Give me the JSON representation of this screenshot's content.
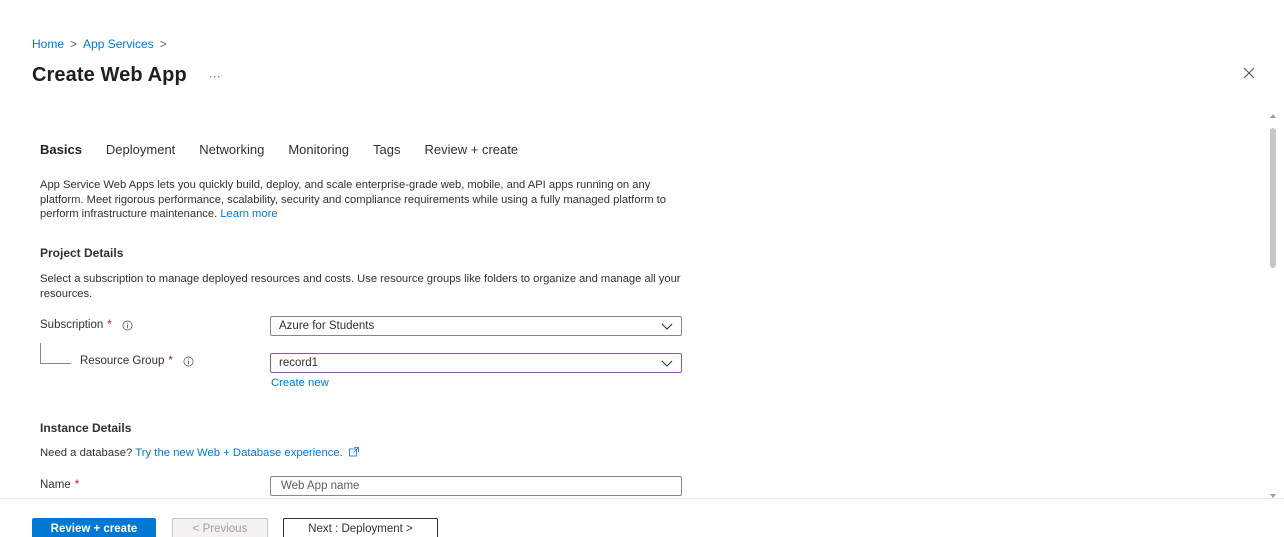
{
  "breadcrumb": {
    "home": "Home",
    "sep": ">",
    "app_services": "App Services"
  },
  "header": {
    "title": "Create Web App",
    "more": "···"
  },
  "tabs": [
    {
      "label": "Basics"
    },
    {
      "label": "Deployment"
    },
    {
      "label": "Networking"
    },
    {
      "label": "Monitoring"
    },
    {
      "label": "Tags"
    },
    {
      "label": "Review + create"
    }
  ],
  "intro": {
    "text": "App Service Web Apps lets you quickly build, deploy, and scale enterprise-grade web, mobile, and API apps running on any platform. Meet rigorous performance, scalability, security and compliance requirements while using a fully managed platform to perform infrastructure maintenance.",
    "learn_more": "Learn more"
  },
  "project_details": {
    "title": "Project Details",
    "description": "Select a subscription to manage deployed resources and costs. Use resource groups like folders to organize and manage all your resources.",
    "subscription_label": "Subscription",
    "subscription_value": "Azure for Students",
    "resource_group_label": "Resource Group",
    "resource_group_value": "record1",
    "create_new": "Create new"
  },
  "instance_details": {
    "title": "Instance Details",
    "db_prefix": "Need a database?",
    "db_link": "Try the new Web + Database experience.",
    "name_label": "Name",
    "name_placeholder": "Web App name"
  },
  "required_marker": "*",
  "footer": {
    "review_create": "Review + create",
    "previous": "< Previous",
    "next": "Next : Deployment >"
  },
  "colors": {
    "accent": "#0078d4",
    "required": "#a4262c",
    "focus_border": "#8a5a9c"
  }
}
